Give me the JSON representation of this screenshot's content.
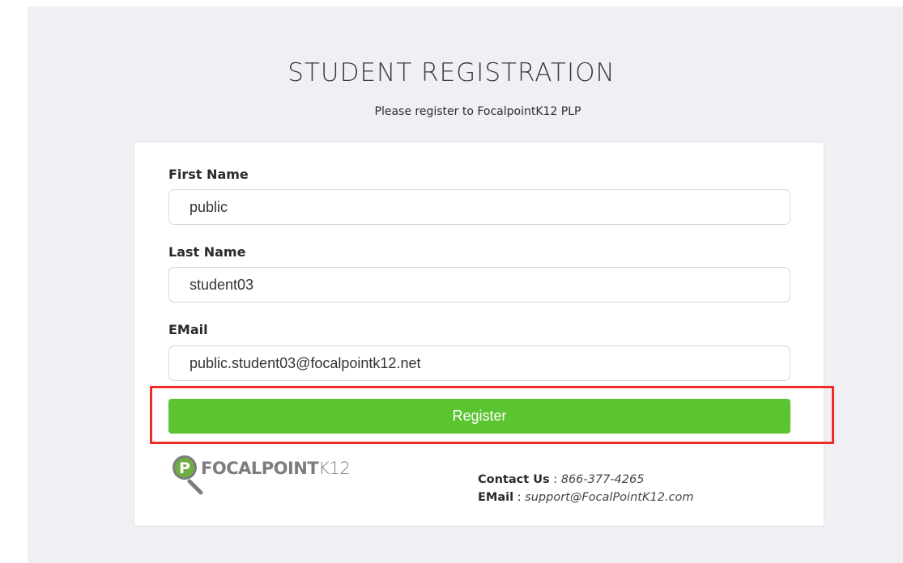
{
  "header": {
    "title": "STUDENT REGISTRATION",
    "subtitle": "Please register to FocalpointK12 PLP"
  },
  "form": {
    "first_name": {
      "label": "First Name",
      "value": "public"
    },
    "last_name": {
      "label": "Last Name",
      "value": "student03"
    },
    "email": {
      "label": "EMail",
      "value": "public.student03@focalpointk12.net"
    },
    "register_label": "Register"
  },
  "footer": {
    "logo": {
      "text_bold": "FOCALPOINT",
      "text_light": "K12",
      "icon": "magnifier-p-icon"
    },
    "contact": {
      "phone_label": "Contact Us",
      "separator": " : ",
      "phone": "866-377-4265",
      "email_label": "EMail",
      "email": "support@FocalPointK12.com"
    }
  },
  "colors": {
    "background": "#f0eff4",
    "button": "#5ac531",
    "highlight": "#ee2b24",
    "logo_green": "#6dae3f",
    "logo_gray": "#7d7d7d"
  }
}
